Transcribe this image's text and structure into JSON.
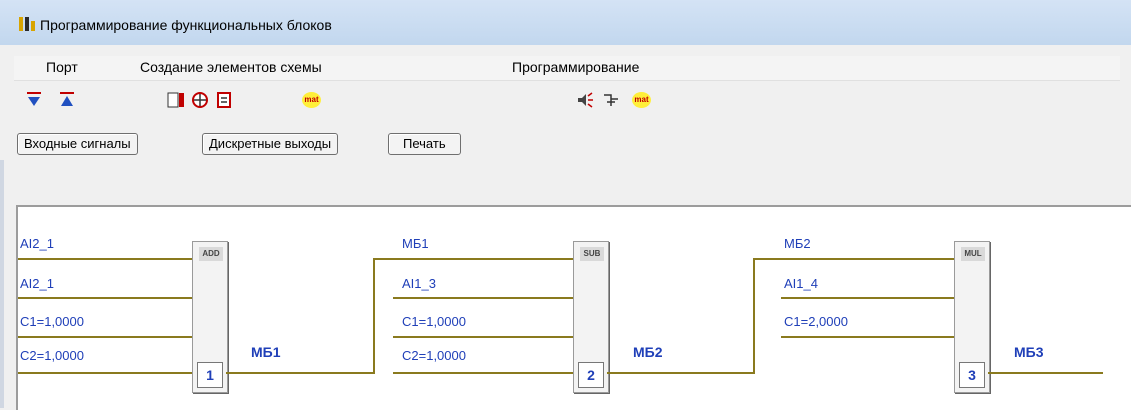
{
  "window": {
    "title": "Программирование функциональных блоков"
  },
  "menu": {
    "items": [
      "Порт",
      "Создание элементов схемы",
      "Программирование"
    ]
  },
  "toolbar": {
    "mat_label_1": "mat",
    "mat_label_2": "mat"
  },
  "buttons": {
    "inputs": "Входные сигналы",
    "discrete_outputs": "Дискретные выходы",
    "print": "Печать"
  },
  "blocks": [
    {
      "op": "ADD",
      "number": "1",
      "inputs": [
        "AI2_1",
        "AI2_1",
        "C1=1,0000",
        "C2=1,0000"
      ],
      "output": "МБ1"
    },
    {
      "op": "SUB",
      "number": "2",
      "inputs": [
        "МБ1",
        "AI1_3",
        "C1=1,0000",
        "C2=1,0000"
      ],
      "output": "МБ2"
    },
    {
      "op": "MUL",
      "number": "3",
      "inputs": [
        "МБ2",
        "AI1_4",
        "C1=2,0000",
        ""
      ],
      "output": "МБ3"
    }
  ],
  "colors": {
    "wire": "#8a7a1e",
    "label": "#1f3fb8",
    "title_bar": "#c2d7ee"
  }
}
